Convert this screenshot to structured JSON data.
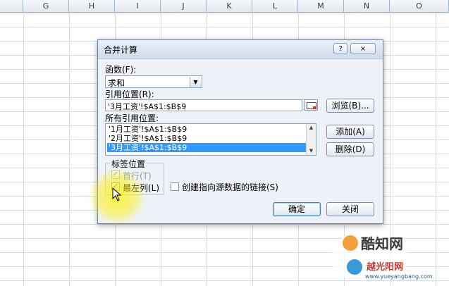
{
  "sheet": {
    "columns": [
      "G",
      "H",
      "I",
      "J",
      "K",
      "L",
      "M",
      "N",
      "O"
    ]
  },
  "dialog": {
    "title": "合并计算",
    "help_label": "?",
    "close_label": "×",
    "function_label": "函数(F):",
    "function_value": "求和",
    "reference_label": "引用位置(R):",
    "reference_value": "'3月工资'!$A$1:$B$9",
    "browse_label": "浏览(B)...",
    "all_refs_label": "所有引用位置:",
    "all_refs": [
      "'1月工资'!$A$1:$B$9",
      "'2月工资'!$A$1:$B$9",
      "'3月工资'!$A$1:$B$9"
    ],
    "selected_ref_index": 2,
    "add_label": "添加(A)",
    "delete_label": "删除(D)",
    "labels_group": "标签位置",
    "first_row_label": "首行(T)",
    "first_row_checked": true,
    "left_col_label": "最左列(L)",
    "left_col_checked": true,
    "link_label": "创建指向源数据的链接(S)",
    "link_checked": false,
    "ok_label": "确定",
    "close_button_label": "关闭"
  },
  "watermark": {
    "line1": "酷知网",
    "line2": "越光阳网",
    "url": "www.yueyangbang.com"
  },
  "colors": {
    "selection": "#3399ff",
    "highlight": "#fff000"
  }
}
